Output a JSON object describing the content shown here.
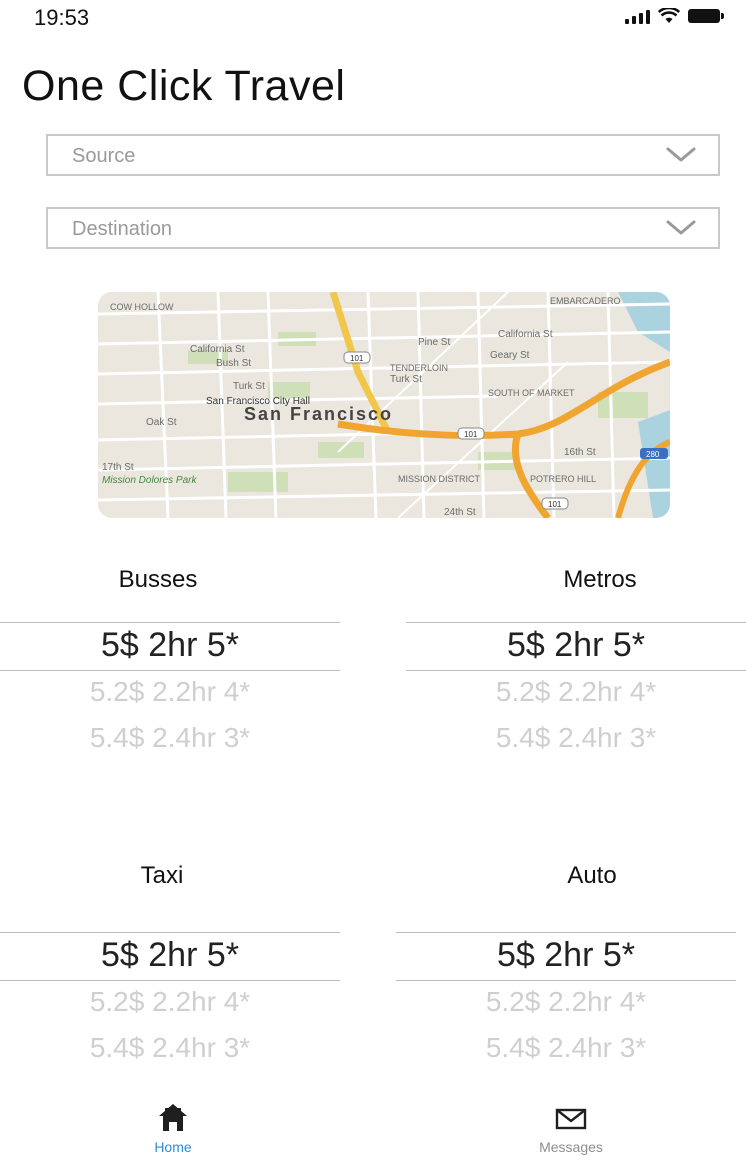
{
  "status_bar": {
    "time": "19:53"
  },
  "app": {
    "title": "One Click Travel"
  },
  "form": {
    "source_placeholder": "Source",
    "destination_placeholder": "Destination"
  },
  "map": {
    "labels": {
      "cow_hollow": "COW HOLLOW",
      "embarcadero": "EMBARCADERO",
      "california_st": "California St",
      "california_st_2": "California St",
      "bush_st": "Bush St",
      "pine_st": "Pine St",
      "geary_st": "Geary St",
      "tenderloin": "TENDERLOIN",
      "turk_st_1": "Turk St",
      "turk_st_2": "Turk St",
      "city_hall": "San Francisco City Hall",
      "san_francisco": "San Francisco",
      "oak_st": "Oak St",
      "south_of_market": "SOUTH OF MARKET",
      "mission_district": "MISSION DISTRICT",
      "potrero_hill": "POTRERO HILL",
      "mission_dolores": "Mission Dolores Park",
      "st_17": "17th St",
      "st_16": "16th St",
      "st_24": "24th St",
      "hwy_101": "101",
      "hwy_101_b": "101",
      "hwy_101_c": "101",
      "hwy_280": "280"
    }
  },
  "pickers": [
    {
      "title": "Busses",
      "options": [
        "5$ 2hr 5*",
        "5.2$ 2.2hr 4*",
        "5.4$ 2.4hr 3*"
      ]
    },
    {
      "title": "Metros",
      "options": [
        "5$ 2hr 5*",
        "5.2$ 2.2hr 4*",
        "5.4$ 2.4hr 3*"
      ]
    },
    {
      "title": "Taxi",
      "options": [
        "5$ 2hr 5*",
        "5.2$ 2.2hr 4*",
        "5.4$ 2.4hr 3*"
      ]
    },
    {
      "title": "Auto",
      "options": [
        "5$ 2hr 5*",
        "5.2$ 2.2hr 4*",
        "5.4$ 2.4hr 3*"
      ]
    }
  ],
  "tabbar": {
    "home_label": "Home",
    "messages_label": "Messages",
    "active_color": "#2f8ddb",
    "inactive_color": "#8e8e8e"
  }
}
